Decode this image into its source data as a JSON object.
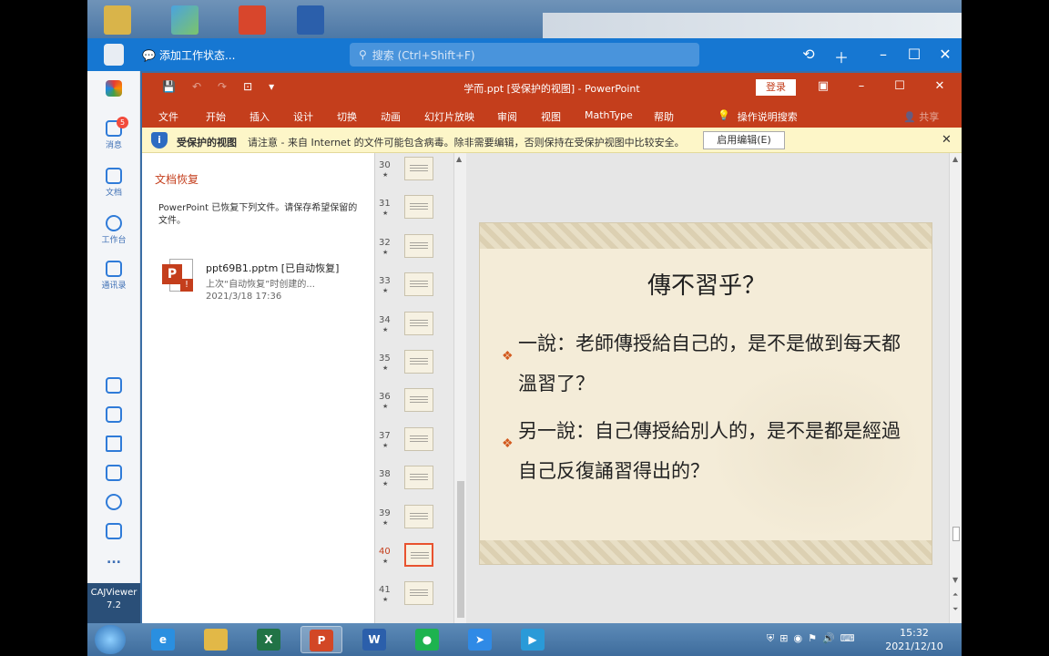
{
  "dingtalk": {
    "status": "添加工作状态...",
    "search_placeholder": "搜索 (Ctrl+Shift+F)",
    "sidebar": [
      {
        "label": "消息",
        "badge": "5"
      },
      {
        "label": "文档"
      },
      {
        "label": "工作台"
      },
      {
        "label": "通讯录"
      }
    ],
    "more": "...",
    "caj_label": "CAJViewer",
    "caj_version": "7.2"
  },
  "ppt": {
    "title": "学而.ppt [受保护的视图] - PowerPoint",
    "login_label": "登录",
    "tabs": [
      "文件",
      "开始",
      "插入",
      "设计",
      "切换",
      "动画",
      "幻灯片放映",
      "审阅",
      "视图",
      "MathType",
      "帮助"
    ],
    "tellme": "操作说明搜索",
    "share": "共享",
    "protected": {
      "title": "受保护的视图",
      "message": "请注意 - 来自 Internet 的文件可能包含病毒。除非需要编辑，否则保持在受保护视图中比较安全。",
      "enable_button": "启用编辑(E)"
    },
    "recovery": {
      "title": "文档恢复",
      "description": "PowerPoint 已恢复下列文件。请保存希望保留的文件。",
      "file_name": "ppt69B1.pptm  [已自动恢复]",
      "file_sub": "上次“自动恢复”时创建的...",
      "file_date": "2021/3/18 17:36"
    },
    "thumbnails": [
      "30",
      "31",
      "32",
      "33",
      "34",
      "35",
      "36",
      "37",
      "38",
      "39",
      "40",
      "41"
    ],
    "active_thumbnail": "40",
    "slide": {
      "title": "傳不習乎？",
      "bullets": [
        "一說：老師傳授給自己的，是不是做到每天都溫習了？",
        "另一說：自己傳授給別人的，是不是都是經過自己反復誦習得出的？"
      ]
    }
  },
  "taskbar": {
    "apps": [
      {
        "name": "ie",
        "label": "e"
      },
      {
        "name": "explorer",
        "label": ""
      },
      {
        "name": "excel",
        "label": "X"
      },
      {
        "name": "powerpoint",
        "label": "P",
        "active": true
      },
      {
        "name": "word",
        "label": "W"
      },
      {
        "name": "wechat",
        "label": "●"
      },
      {
        "name": "dingtalk",
        "label": "➤"
      },
      {
        "name": "video",
        "label": "▶"
      }
    ],
    "time": "15:32",
    "date": "2021/12/10"
  },
  "colors": {
    "ppt_accent": "#c43e1c",
    "dingtalk_blue": "#1677d2",
    "slide_bg": "#f4ecd8"
  }
}
